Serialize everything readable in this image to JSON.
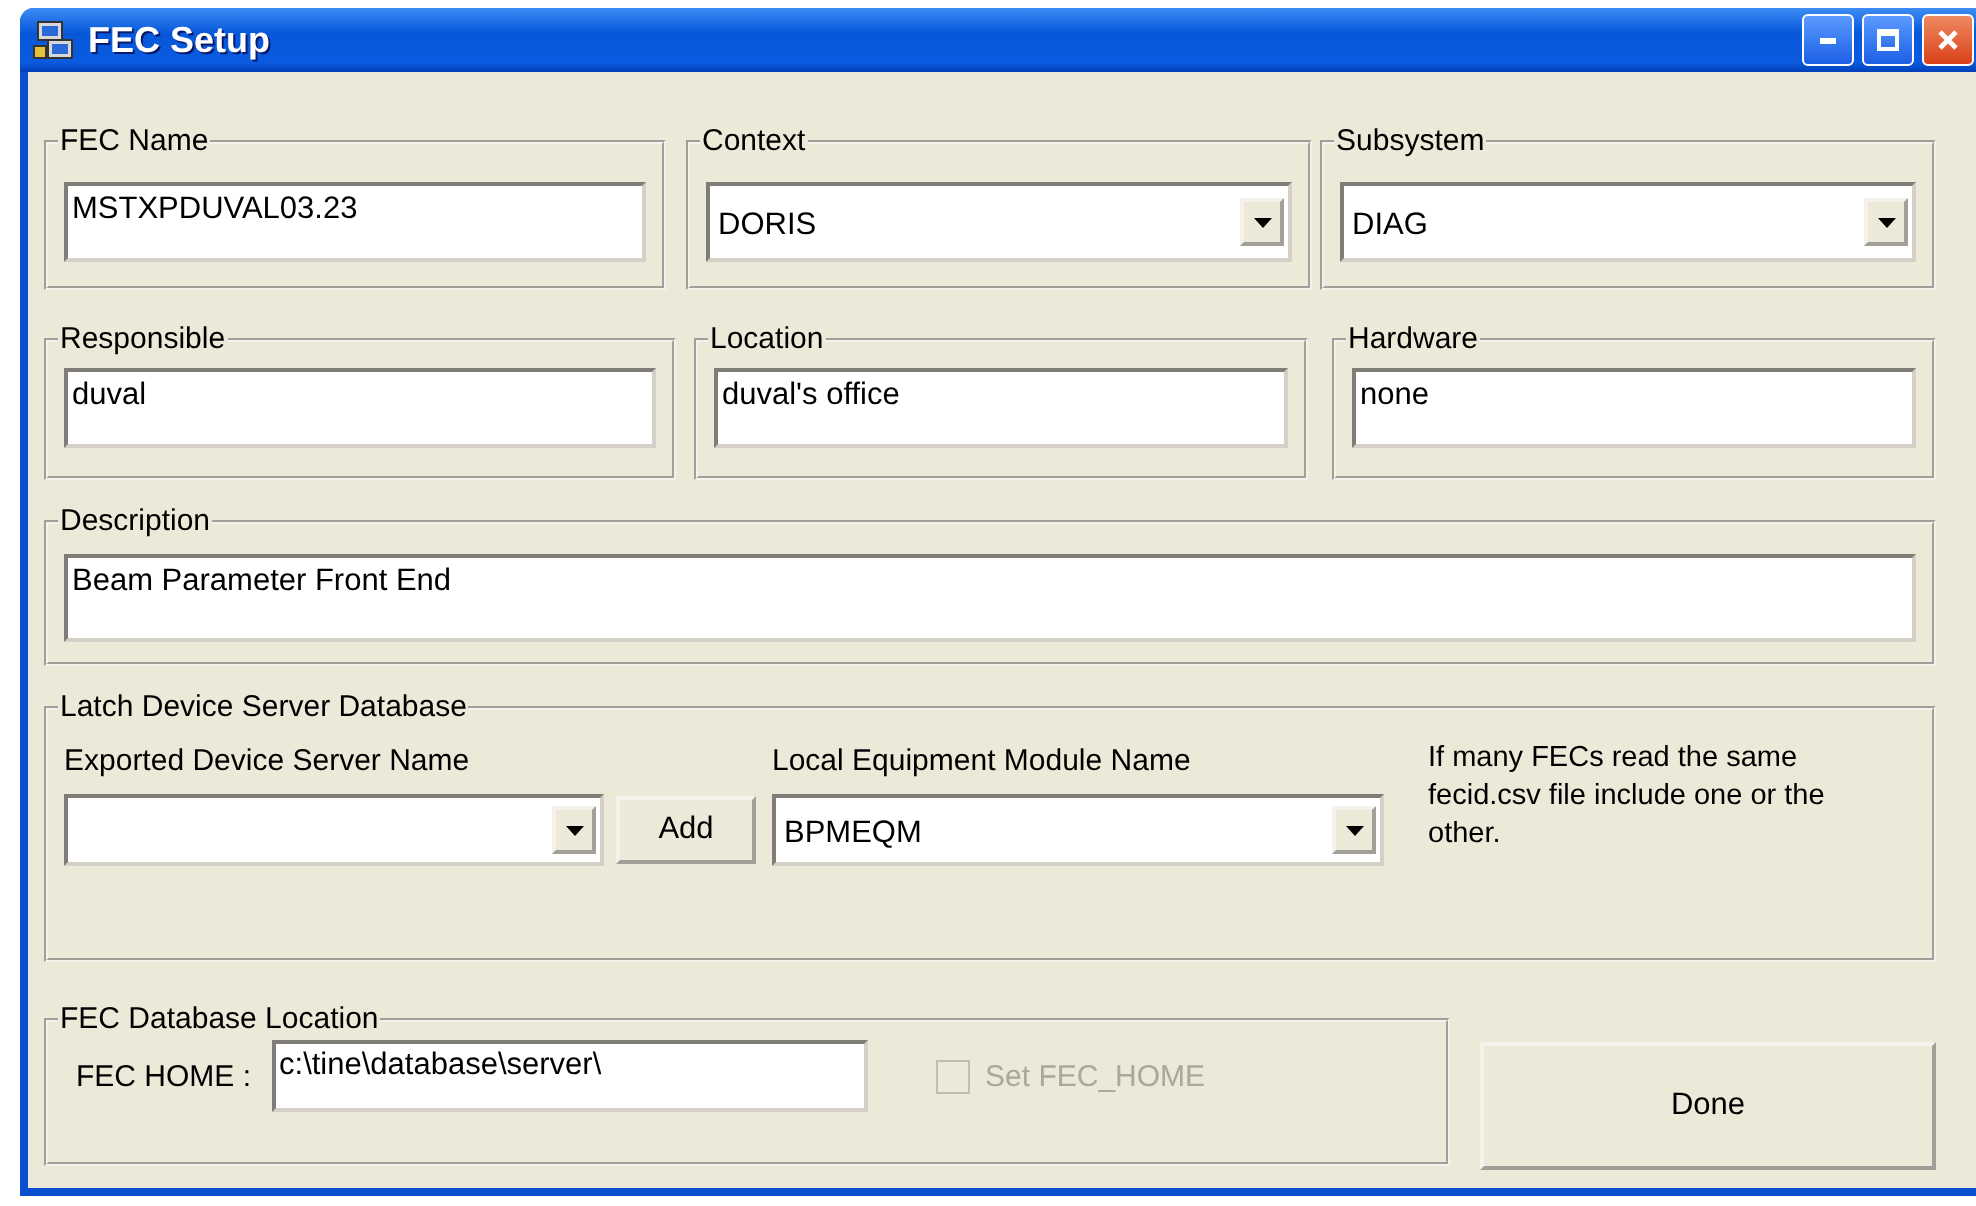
{
  "window": {
    "title": "FEC Setup"
  },
  "field_rows": [
    {
      "fields": [
        {
          "label": "FEC Name",
          "kind": "text",
          "value": "MSTXPDUVAL03.23"
        },
        {
          "label": "Context",
          "kind": "dropdown",
          "value": "DORIS"
        },
        {
          "label": "Subsystem",
          "kind": "dropdown",
          "value": "DIAG"
        }
      ]
    },
    {
      "fields": [
        {
          "label": "Responsible",
          "kind": "text",
          "value": "duval"
        },
        {
          "label": "Location",
          "kind": "text",
          "value": "duval's office"
        },
        {
          "label": "Hardware",
          "kind": "text",
          "value": "none"
        }
      ]
    },
    {
      "fields": [
        {
          "label": "Description",
          "kind": "text",
          "value": "Beam Parameter Front End"
        }
      ]
    }
  ],
  "latch": {
    "title": "Latch Device Server Database",
    "exported_label": "Exported Device Server Name",
    "add_button": "Add",
    "module_label": "Local Equipment Module Name",
    "module_value": "BPMEQM",
    "note": "If many FECs read the same fecid.csv file include one or the other."
  },
  "database": {
    "title": "FEC Database Location",
    "home_label": "FEC HOME :",
    "home_value": "c:\\tine\\database\\server\\",
    "checkbox": {
      "label": "Set FEC_HOME",
      "checked": false,
      "disabled": true
    }
  },
  "done_button": "Done"
}
